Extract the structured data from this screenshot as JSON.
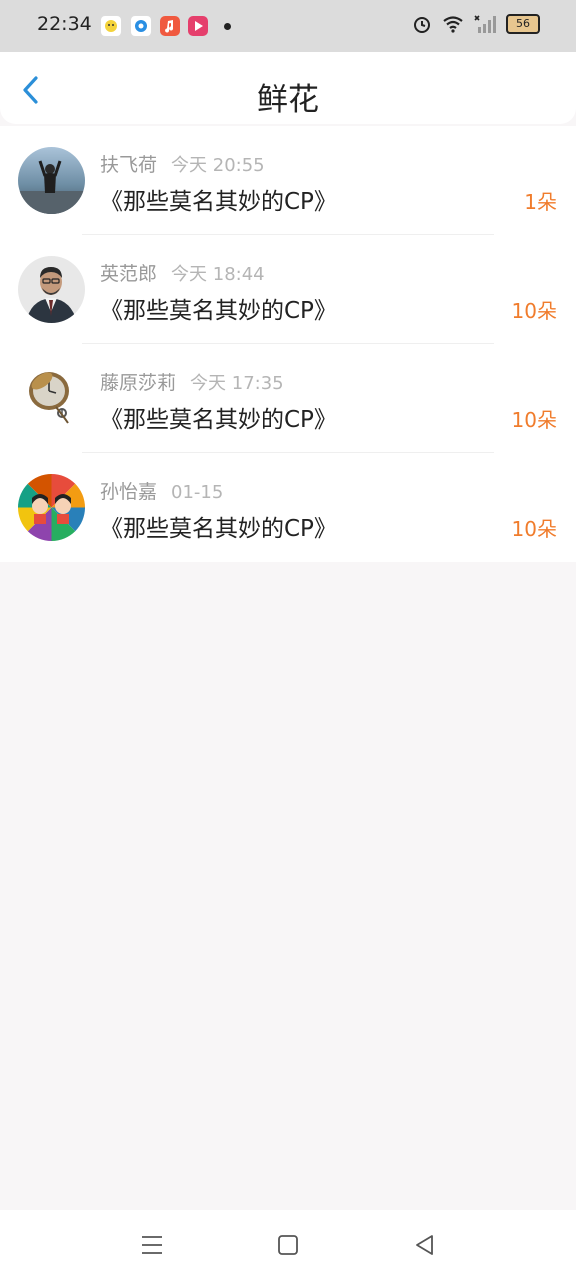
{
  "status_bar": {
    "time": "22:34",
    "battery": "56"
  },
  "header": {
    "title": "鲜花"
  },
  "items": [
    {
      "name": "扶飞荷",
      "time": "今天 20:55",
      "book": "《那些莫名其妙的CP》",
      "count": "1朵"
    },
    {
      "name": "英范郎",
      "time": "今天 18:44",
      "book": "《那些莫名其妙的CP》",
      "count": "10朵"
    },
    {
      "name": "藤原莎莉",
      "time": "今天 17:35",
      "book": "《那些莫名其妙的CP》",
      "count": "10朵"
    },
    {
      "name": "孙怡嘉",
      "time": "01-15",
      "book": "《那些莫名其妙的CP》",
      "count": "10朵"
    }
  ],
  "colors": {
    "accent": "#f07c2c",
    "back": "#2b8fd8"
  }
}
